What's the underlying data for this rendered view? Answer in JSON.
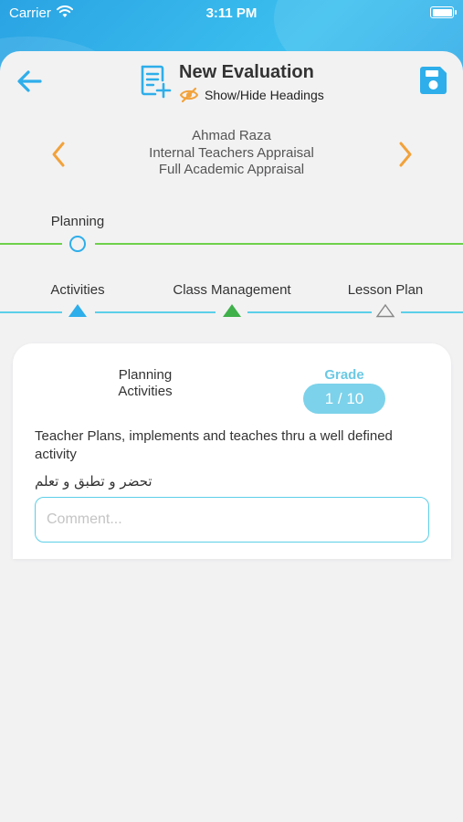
{
  "status_bar": {
    "carrier": "Carrier",
    "time": "3:11 PM"
  },
  "header": {
    "title": "New Evaluation",
    "toggle_headings_label": "Show/Hide Headings",
    "icons": {
      "back": "arrow-left-icon",
      "title": "add-document-icon",
      "toggle": "eye-off-icon",
      "save": "save-icon"
    }
  },
  "evaluation": {
    "teacher_name": "Ahmad Raza",
    "appraisal_type": "Internal Teachers Appraisal",
    "appraisal_form": "Full Academic Appraisal"
  },
  "section_step": {
    "label": "Planning"
  },
  "tabs": [
    {
      "label": "Activities",
      "state": "selected"
    },
    {
      "label": "Class Management",
      "state": "completed"
    },
    {
      "label": "Lesson Plan",
      "state": "pending"
    }
  ],
  "card": {
    "heading": "Planning Activities",
    "grade_label": "Grade",
    "grade_value": "1 / 10",
    "criterion_text": "Teacher Plans, implements and teaches thru a well defined activity",
    "criterion_text_ar": "تحضر و تطبق و تعلم",
    "comment_placeholder": "Comment...",
    "comment_value": ""
  },
  "colors": {
    "accent_blue": "#2eaeea",
    "arrow_orange": "#f2a23a",
    "progress_green": "#6ed14a",
    "tab_cyan": "#5ccfe8",
    "tab_completed_green": "#3fb04a",
    "grade_pill": "#7cd2ea"
  }
}
